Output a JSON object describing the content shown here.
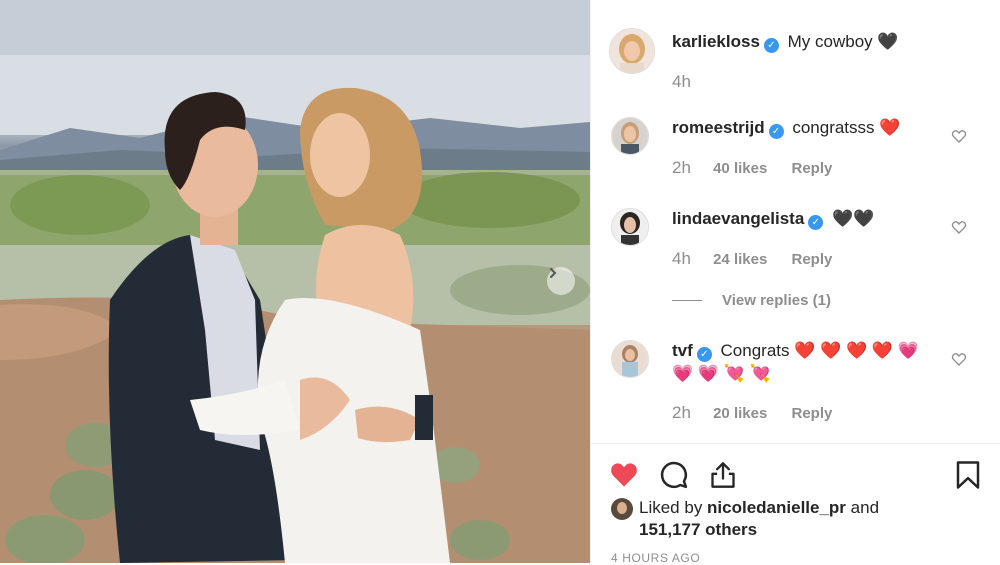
{
  "post": {
    "author": "karliekloss",
    "caption": "My cowboy 🖤",
    "time": "4h"
  },
  "comments": [
    {
      "username": "romeestrijd",
      "text": "congratsss ❤️",
      "time": "2h",
      "likes": "40 likes",
      "reply": "Reply"
    },
    {
      "username": "lindaevangelista",
      "text": "🖤🖤",
      "time": "4h",
      "likes": "24 likes",
      "reply": "Reply",
      "view_replies": "View replies (1)"
    },
    {
      "username": "tvf",
      "text": "Congrats ❤️ ❤️ ❤️ ❤️ 💗",
      "text_line2": "💗 💗 💘 💘",
      "time": "2h",
      "likes": "20 likes",
      "reply": "Reply"
    }
  ],
  "likes_summary": {
    "prefix": "Liked by ",
    "user": "nicoledanielle_pr",
    "middle": " and",
    "others": "151,177 others"
  },
  "timestamp": "4 HOURS AGO",
  "colors": {
    "liked_heart": "#ed4956",
    "verified": "#3897f0",
    "muted": "#8e8e8e"
  },
  "icons": [
    "heart-filled-icon",
    "comment-icon",
    "share-icon",
    "bookmark-icon",
    "chevron-right-icon",
    "verified-badge-icon",
    "heart-outline-icon"
  ]
}
